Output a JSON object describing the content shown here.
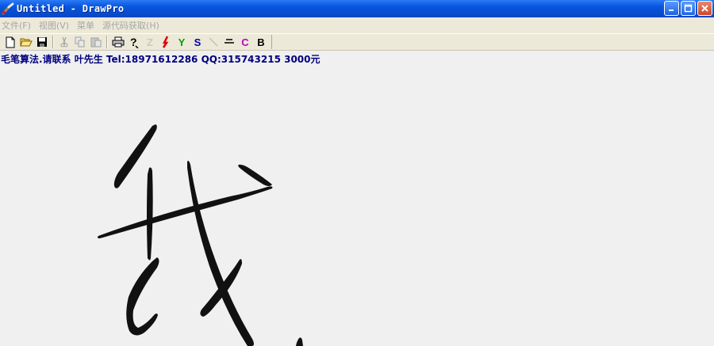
{
  "window": {
    "title": "Untitled - DrawPro",
    "icon": "paintbrush-icon",
    "controls": [
      "minimize-icon",
      "maximize-icon",
      "close-icon"
    ]
  },
  "menu": {
    "items": [
      "文件(F)",
      "视图(V)",
      "菜单",
      "源代码获取(H)"
    ]
  },
  "toolbar": {
    "icons": [
      "new-document-icon",
      "open-folder-icon",
      "save-icon",
      "cut-icon",
      "copy-icon",
      "paste-icon",
      "print-icon",
      "help-icon"
    ],
    "buttons": {
      "z": "Z",
      "y": "Y",
      "s": "S",
      "c": "C",
      "b": "B"
    },
    "colors": {
      "z": "#c0c0c0",
      "y": "#00a000",
      "s": "#0000aa",
      "c": "#c000c0",
      "b": "#000000",
      "red_tool": "#e00000"
    }
  },
  "canvas": {
    "info": "毛笔算法.请联系 叶先生 Tel:18971612286 QQ:315743215 3000元",
    "info_color": "#00007f",
    "stroke_color": "#111111"
  }
}
